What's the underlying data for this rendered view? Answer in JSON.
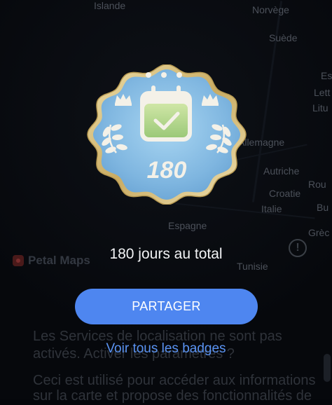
{
  "map": {
    "labels": [
      "Islande",
      "Norvège",
      "Suède",
      "Allemagne",
      "Autriche",
      "Croatie",
      "Italie",
      "Espagne",
      "Tunisie",
      "Rou",
      "Bu",
      "Grèc",
      "Lett",
      "Litu",
      "Es"
    ],
    "brand": "Petal Maps"
  },
  "background_sheet": {
    "line1": "Les Services de localisation ne sont pas",
    "line2": "activés. Activer les paramètres ?",
    "line3": "Ceci est utilisé pour accéder aux informations",
    "line4": "sur la carte et propose des fonctionnalités de"
  },
  "badge": {
    "count": "180",
    "icon": "calendar-check-icon",
    "colors": {
      "face": "#8cc2e6",
      "rim": "#d8c286",
      "laurel": "#f4f1e8",
      "calendar": "#b7d78e"
    }
  },
  "caption": "180 jours au total",
  "share_button": "PARTAGER",
  "view_all_link": "Voir tous les badges",
  "colors": {
    "accent": "#4e86f0",
    "link": "#5a93f2",
    "background": "#05070b"
  }
}
